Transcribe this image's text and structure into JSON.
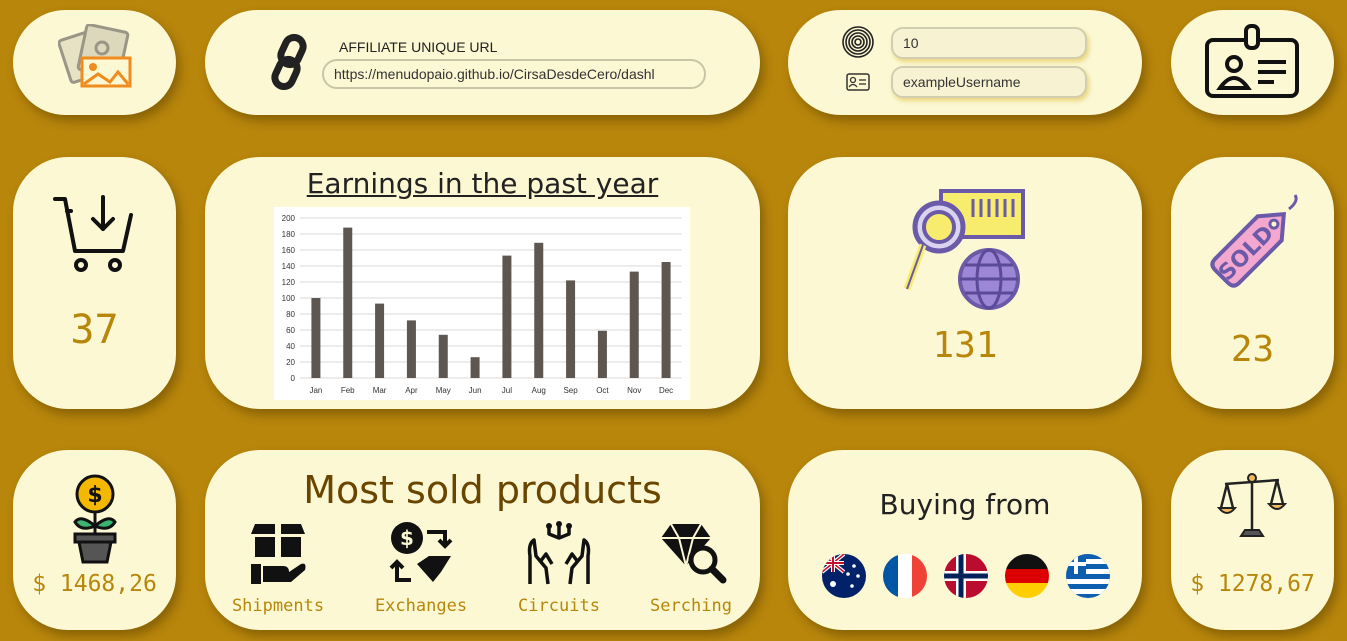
{
  "affiliate": {
    "label": "AFFILIATE UNIQUE URL",
    "url_value": "https://menudopaio.github.io/CirsaDesdeCero/dashl"
  },
  "login": {
    "id_value": "10",
    "username_value": "exampleUsername"
  },
  "stats": {
    "cart_count": "37",
    "search_count": "131",
    "sold_count": "23",
    "earnings_money": "$ 1468,26",
    "balance_money": "$ 1278,67"
  },
  "chart_data": {
    "type": "bar",
    "title": "Earnings in the past year",
    "categories": [
      "Jan",
      "Feb",
      "Mar",
      "Apr",
      "May",
      "Jun",
      "Jul",
      "Aug",
      "Sep",
      "Oct",
      "Nov",
      "Dec"
    ],
    "values": [
      100,
      188,
      93,
      72,
      54,
      26,
      153,
      169,
      122,
      59,
      133,
      145
    ],
    "ylim": [
      0,
      200
    ],
    "yticks": [
      0,
      20,
      40,
      60,
      80,
      100,
      120,
      140,
      160,
      180,
      200
    ],
    "grid": true,
    "bar_color": "#5e5650"
  },
  "products": {
    "title": "Most sold products",
    "items": [
      {
        "label": "Shipments",
        "icon": "box-hand-icon"
      },
      {
        "label": "Exchanges",
        "icon": "money-diamond-exchange-icon"
      },
      {
        "label": "Circuits",
        "icon": "hands-circuit-icon"
      },
      {
        "label": "Serching",
        "icon": "diamond-search-icon"
      }
    ]
  },
  "buying": {
    "title": "Buying from",
    "flags": [
      "australia-flag-icon",
      "france-flag-icon",
      "norway-flag-icon",
      "germany-flag-icon",
      "greece-flag-icon"
    ]
  },
  "colors": {
    "background": "#b8860b",
    "card": "#fbf8d3",
    "accent_text": "#b8860b",
    "products_title": "#6a4500"
  }
}
